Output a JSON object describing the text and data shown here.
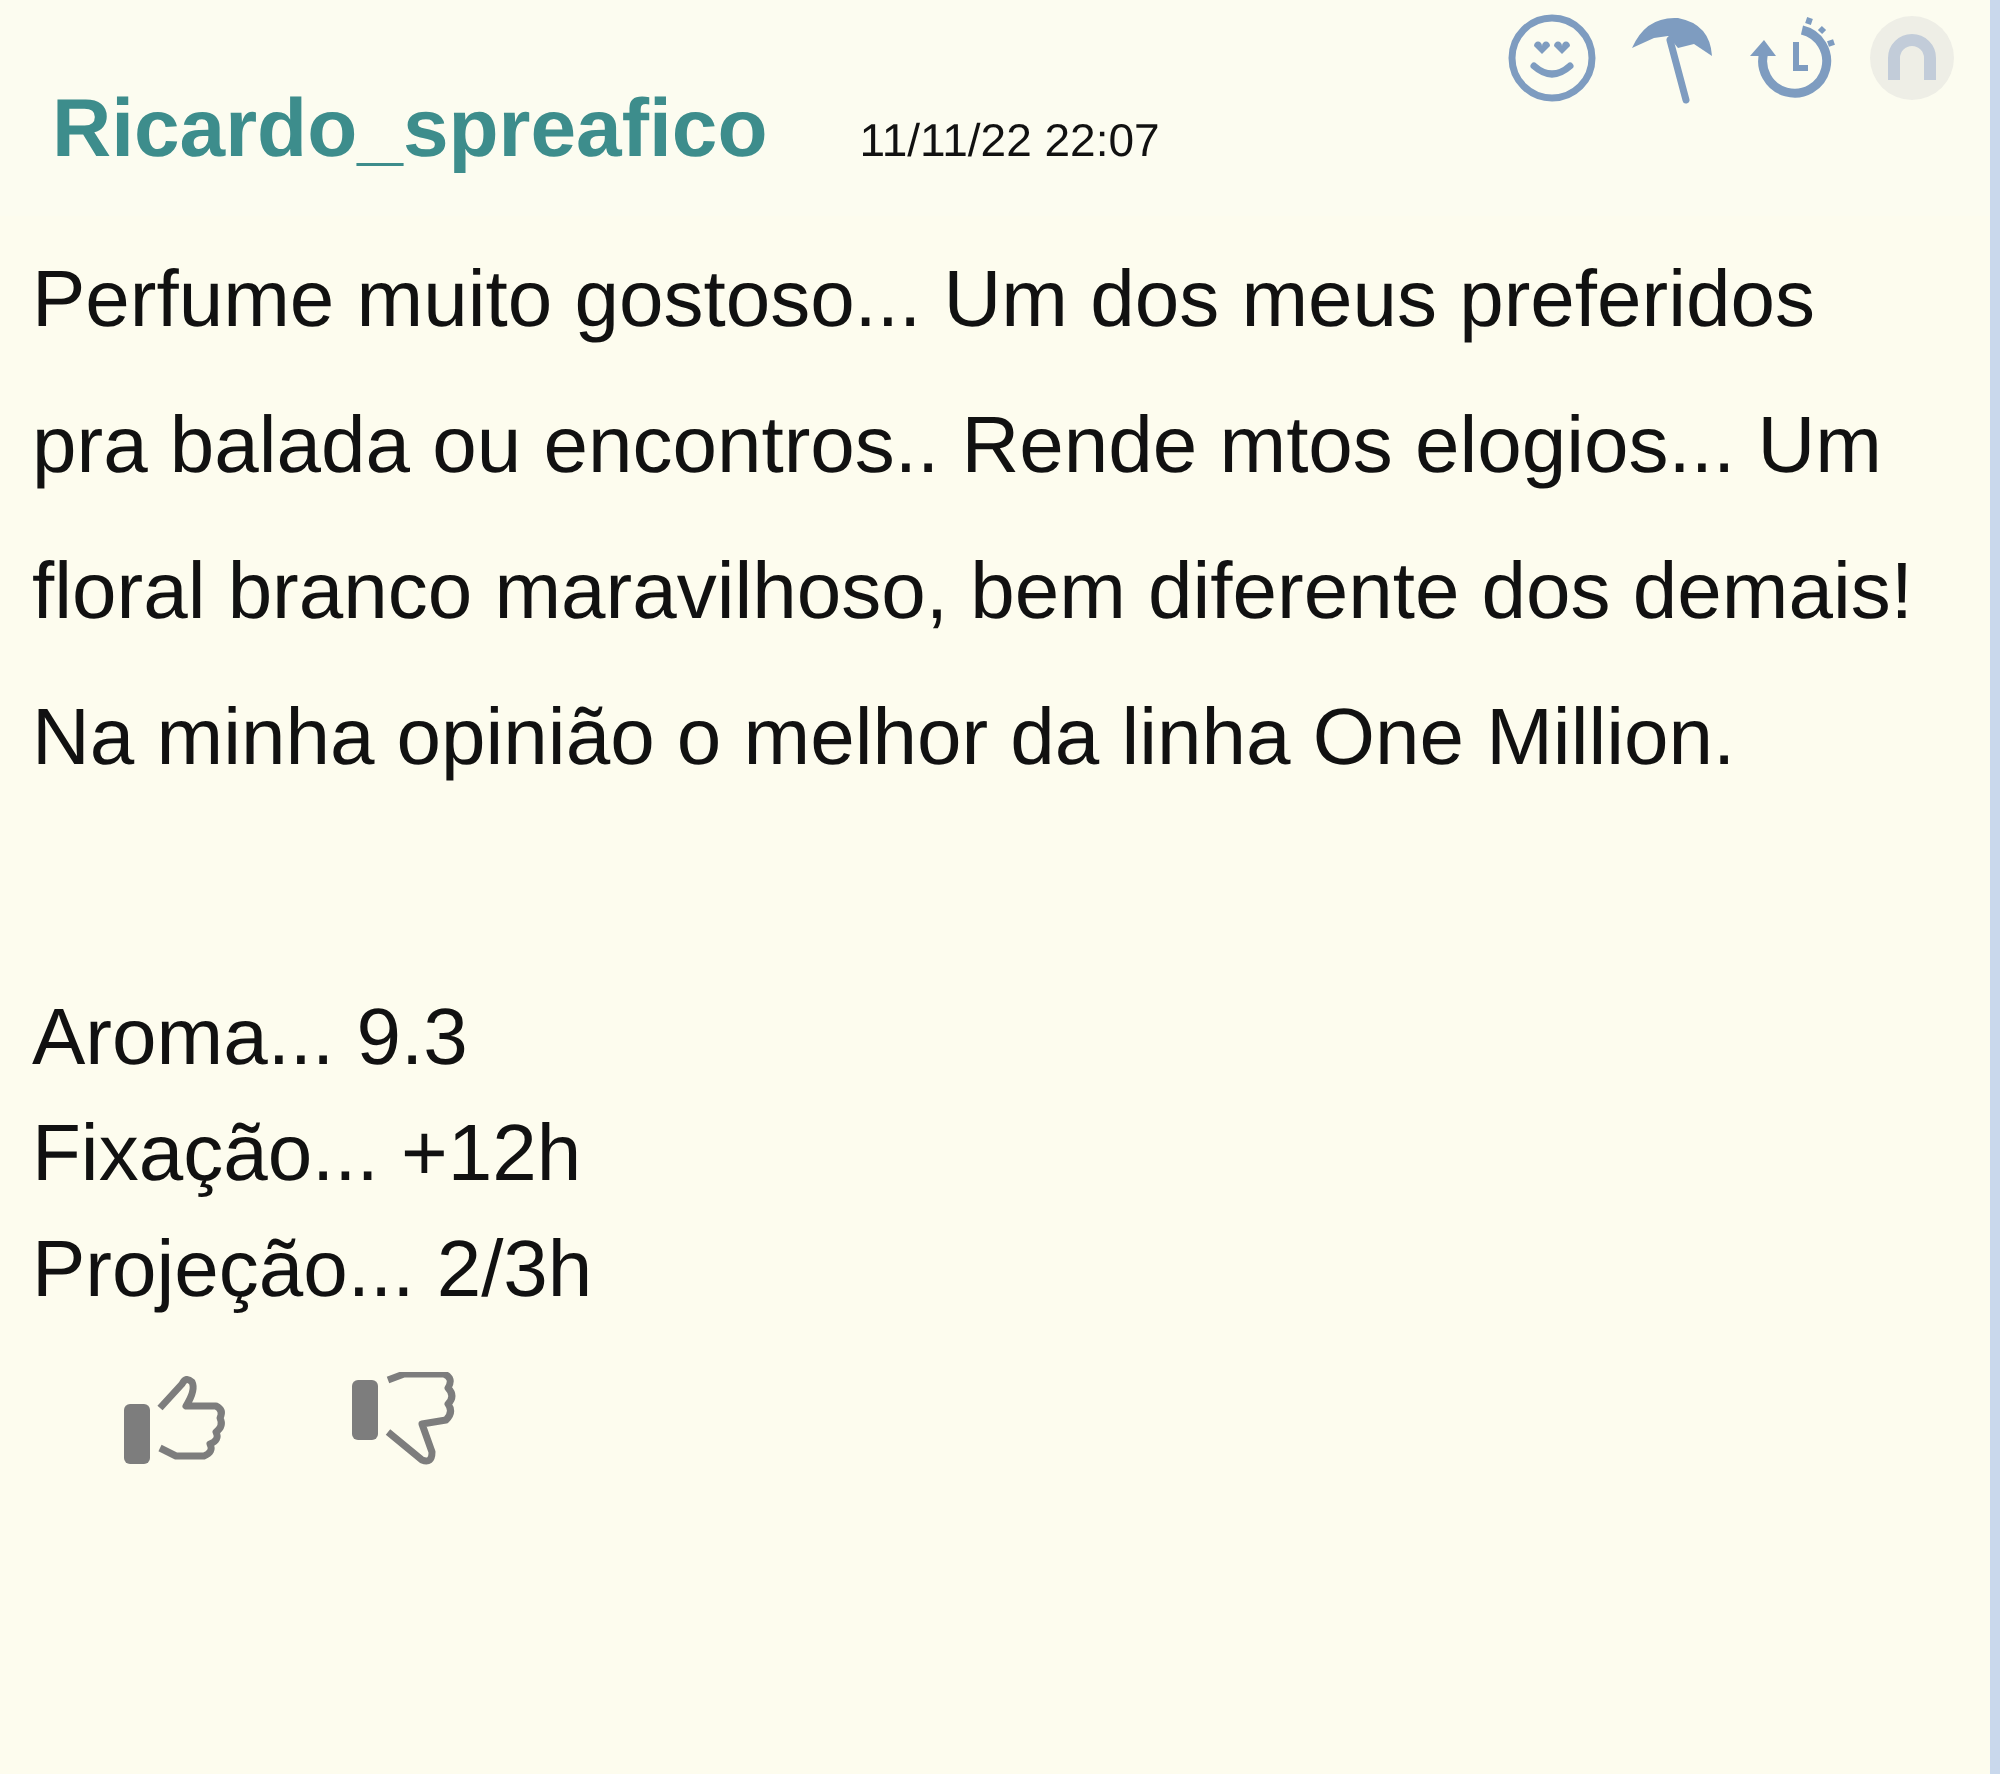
{
  "review": {
    "author": "Ricardo_spreafico",
    "date": "11/11/22 22:07",
    "text": "Perfume muito gostoso... Um dos meus preferidos pra balada ou encontros.. Rende mtos elogios... Um floral branco maravilhoso, bem diferente dos demais! Na minha opinião o melhor da linha One Million.",
    "ratings": [
      "Aroma... 9.3",
      "Fixação... +12h",
      "Projeção... 2/3h"
    ]
  }
}
